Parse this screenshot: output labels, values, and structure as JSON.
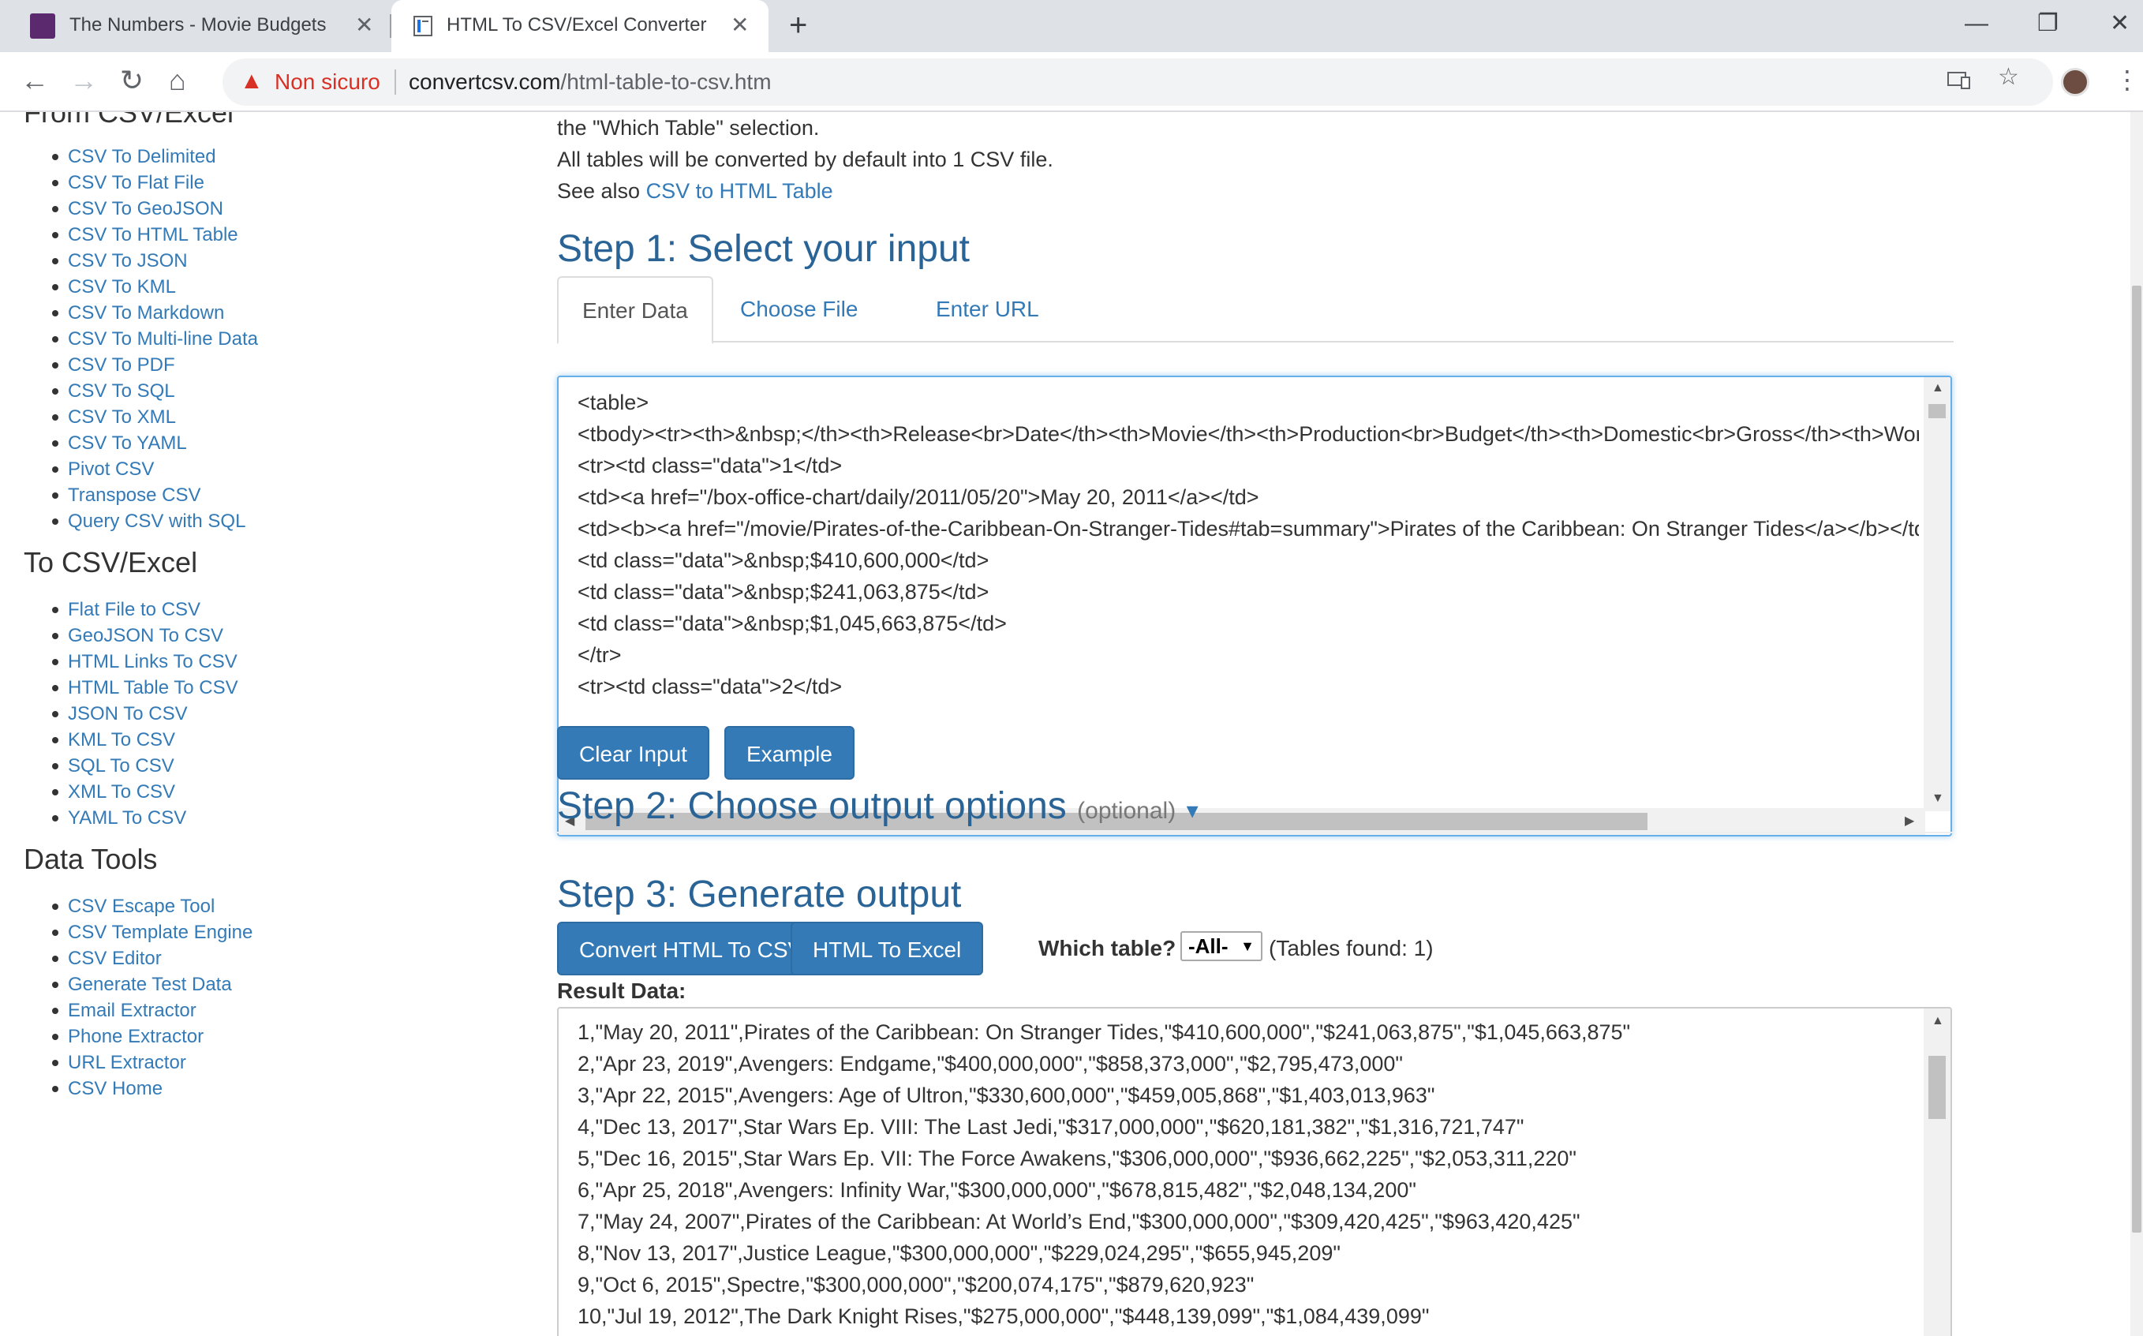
{
  "browser": {
    "tabs": [
      {
        "title": "The Numbers - Movie Budgets",
        "close": "✕"
      },
      {
        "title": "HTML To CSV/Excel Converter",
        "close": "✕"
      }
    ],
    "new_tab": "+",
    "window_controls": [
      "—",
      "❐",
      "✕"
    ],
    "nav": {
      "back": "←",
      "forward": "→",
      "reload": "↻",
      "home": "⌂"
    },
    "security_label": "Non sicuro",
    "url_domain": "convertcsv.com",
    "url_path": "/html-table-to-csv.htm"
  },
  "sidebar": {
    "sections": [
      {
        "heading": "From CSV/Excel",
        "items": [
          "CSV To Delimited",
          "CSV To Flat File",
          "CSV To GeoJSON",
          "CSV To HTML Table",
          "CSV To JSON",
          "CSV To KML",
          "CSV To Markdown",
          "CSV To Multi-line Data",
          "CSV To PDF",
          "CSV To SQL",
          "CSV To XML",
          "CSV To YAML",
          "Pivot CSV",
          "Transpose CSV",
          "Query CSV with SQL"
        ]
      },
      {
        "heading": "To CSV/Excel",
        "items": [
          "Flat File to CSV",
          "GeoJSON To CSV",
          "HTML Links To CSV",
          "HTML Table To CSV",
          "JSON To CSV",
          "KML To CSV",
          "SQL To CSV",
          "XML To CSV",
          "YAML To CSV"
        ]
      },
      {
        "heading": "Data Tools",
        "items": [
          "CSV Escape Tool",
          "CSV Template Engine",
          "CSV Editor",
          "Generate Test Data",
          "Email Extractor",
          "Phone Extractor",
          "URL Extractor",
          "CSV Home"
        ]
      }
    ]
  },
  "main": {
    "intro_line1": "the \"Which Table\" selection.",
    "intro_line2": "All tables will be converted by default into 1 CSV file.",
    "intro_see_also": "See also",
    "intro_link": "CSV to HTML Table",
    "step1_title": "Step 1: Select your input",
    "input_tabs": [
      "Enter Data",
      "Choose File",
      "Enter URL"
    ],
    "input_lines": [
      "<table>",
      "<tbody><tr><th>&nbsp;</th><th>Release<br>Date</th><th>Movie</th><th>Production<br>Budget</th><th>Domestic<br>Gross</th><th>Worldwide<br>Gross</th></tr>",
      "<tr><td class=\"data\">1</td>",
      "<td><a href=\"/box-office-chart/daily/2011/05/20\">May 20, 2011</a></td>",
      "<td><b><a href=\"/movie/Pirates-of-the-Caribbean-On-Stranger-Tides#tab=summary\">Pirates of the Caribbean: On Stranger Tides</a></b></td>",
      "<td class=\"data\">&nbsp;$410,600,000</td>",
      "<td class=\"data\">&nbsp;$241,063,875</td>",
      "<td class=\"data\">&nbsp;$1,045,663,875</td>",
      "</tr>",
      "<tr><td class=\"data\">2</td>"
    ],
    "clear_button": "Clear Input",
    "example_button": "Example",
    "step2_title": "Step 2: Choose output options",
    "step2_optional": "(optional)",
    "step2_chevron": "⌄",
    "step3_title": "Step 3: Generate output",
    "convert_button": "Convert HTML To CSV",
    "excel_button": "HTML To Excel",
    "which_table_label": "Which table?",
    "which_table_value": "-All-",
    "tables_found": "(Tables found: 1)",
    "result_label": "Result Data:",
    "result_lines": [
      "1,\"May 20, 2011\",Pirates of the Caribbean: On Stranger Tides,\"$410,600,000\",\"$241,063,875\",\"$1,045,663,875\"",
      "2,\"Apr 23, 2019\",Avengers: Endgame,\"$400,000,000\",\"$858,373,000\",\"$2,795,473,000\"",
      "3,\"Apr 22, 2015\",Avengers: Age of Ultron,\"$330,600,000\",\"$459,005,868\",\"$1,403,013,963\"",
      "4,\"Dec 13, 2017\",Star Wars Ep. VIII: The Last Jedi,\"$317,000,000\",\"$620,181,382\",\"$1,316,721,747\"",
      "5,\"Dec 16, 2015\",Star Wars Ep. VII: The Force Awakens,\"$306,000,000\",\"$936,662,225\",\"$2,053,311,220\"",
      "6,\"Apr 25, 2018\",Avengers: Infinity War,\"$300,000,000\",\"$678,815,482\",\"$2,048,134,200\"",
      "7,\"May 24, 2007\",Pirates of the Caribbean: At World’s End,\"$300,000,000\",\"$309,420,425\",\"$963,420,425\"",
      "8,\"Nov 13, 2017\",Justice League,\"$300,000,000\",\"$229,024,295\",\"$655,945,209\"",
      "9,\"Oct 6, 2015\",Spectre,\"$300,000,000\",\"$200,074,175\",\"$879,620,923\"",
      "10,\"Jul 19, 2012\",The Dark Knight Rises,\"$275,000,000\",\"$448,139,099\",\"$1,084,439,099\""
    ]
  },
  "colors": {
    "link": "#337ab7",
    "heading": "#2a6496",
    "button": "#337ab7",
    "warning": "#d93025"
  }
}
